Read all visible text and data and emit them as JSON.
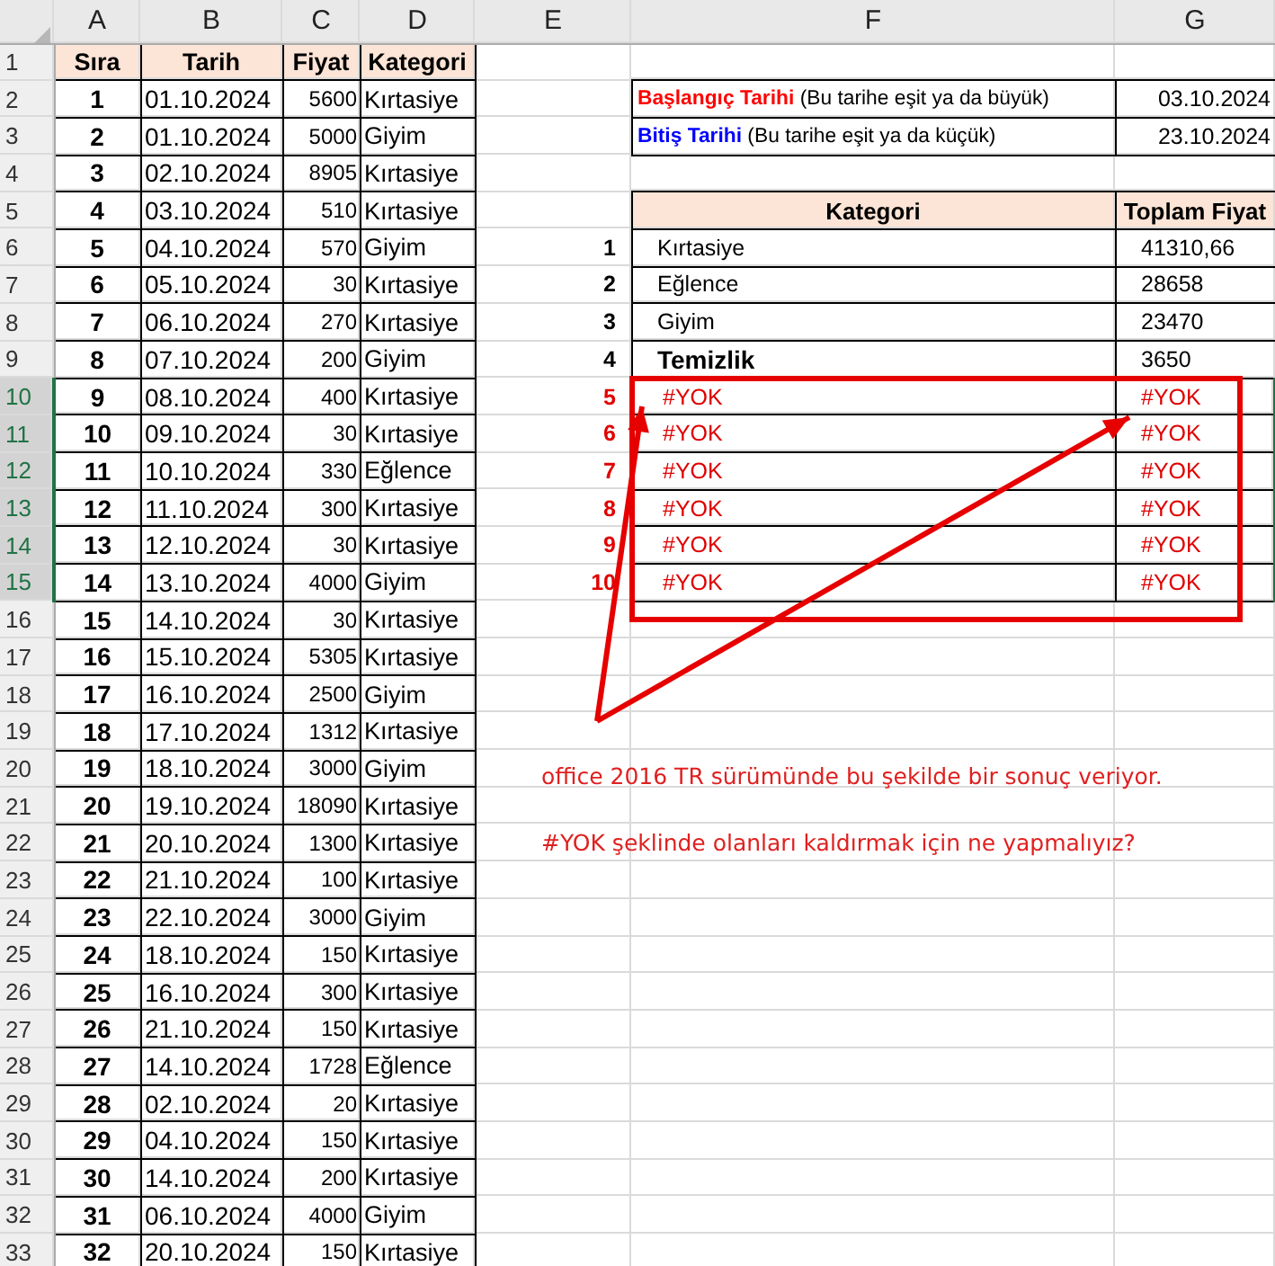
{
  "column_headers": [
    {
      "label": "A"
    },
    {
      "label": "B"
    },
    {
      "label": "C"
    },
    {
      "label": "D"
    },
    {
      "label": "E"
    },
    {
      "label": "F"
    },
    {
      "label": "G"
    }
  ],
  "row_headers": [
    {
      "label": "1",
      "selected": false
    },
    {
      "label": "2",
      "selected": false
    },
    {
      "label": "3",
      "selected": false
    },
    {
      "label": "4",
      "selected": false
    },
    {
      "label": "5",
      "selected": false
    },
    {
      "label": "6",
      "selected": false
    },
    {
      "label": "7",
      "selected": false
    },
    {
      "label": "8",
      "selected": false
    },
    {
      "label": "9",
      "selected": false
    },
    {
      "label": "10",
      "selected": true
    },
    {
      "label": "11",
      "selected": true
    },
    {
      "label": "12",
      "selected": true
    },
    {
      "label": "13",
      "selected": true
    },
    {
      "label": "14",
      "selected": true
    },
    {
      "label": "15",
      "selected": true
    },
    {
      "label": "16",
      "selected": false
    },
    {
      "label": "17",
      "selected": false
    },
    {
      "label": "18",
      "selected": false
    },
    {
      "label": "19",
      "selected": false
    },
    {
      "label": "20",
      "selected": false
    },
    {
      "label": "21",
      "selected": false
    },
    {
      "label": "22",
      "selected": false
    },
    {
      "label": "23",
      "selected": false
    },
    {
      "label": "24",
      "selected": false
    },
    {
      "label": "25",
      "selected": false
    },
    {
      "label": "26",
      "selected": false
    },
    {
      "label": "27",
      "selected": false
    },
    {
      "label": "28",
      "selected": false
    },
    {
      "label": "29",
      "selected": false
    },
    {
      "label": "30",
      "selected": false
    },
    {
      "label": "31",
      "selected": false
    },
    {
      "label": "32",
      "selected": false
    },
    {
      "label": "33",
      "selected": false
    }
  ],
  "data_table": {
    "header": [
      "Sıra",
      "Tarih",
      "Fiyat",
      "Kategori"
    ],
    "rows": [
      {
        "sira": "1",
        "tarih": "01.10.2024",
        "fiyat": "5600",
        "kategori": "Kırtasiye"
      },
      {
        "sira": "2",
        "tarih": "01.10.2024",
        "fiyat": "5000",
        "kategori": "Giyim"
      },
      {
        "sira": "3",
        "tarih": "02.10.2024",
        "fiyat": "8905",
        "kategori": "Kırtasiye"
      },
      {
        "sira": "4",
        "tarih": "03.10.2024",
        "fiyat": "510",
        "kategori": "Kırtasiye"
      },
      {
        "sira": "5",
        "tarih": "04.10.2024",
        "fiyat": "570",
        "kategori": "Giyim"
      },
      {
        "sira": "6",
        "tarih": "05.10.2024",
        "fiyat": "30",
        "kategori": "Kırtasiye"
      },
      {
        "sira": "7",
        "tarih": "06.10.2024",
        "fiyat": "270",
        "kategori": "Kırtasiye"
      },
      {
        "sira": "8",
        "tarih": "07.10.2024",
        "fiyat": "200",
        "kategori": "Giyim"
      },
      {
        "sira": "9",
        "tarih": "08.10.2024",
        "fiyat": "400",
        "kategori": "Kırtasiye"
      },
      {
        "sira": "10",
        "tarih": "09.10.2024",
        "fiyat": "30",
        "kategori": "Kırtasiye"
      },
      {
        "sira": "11",
        "tarih": "10.10.2024",
        "fiyat": "330",
        "kategori": "Eğlence"
      },
      {
        "sira": "12",
        "tarih": "11.10.2024",
        "fiyat": "300",
        "kategori": "Kırtasiye"
      },
      {
        "sira": "13",
        "tarih": "12.10.2024",
        "fiyat": "30",
        "kategori": "Kırtasiye"
      },
      {
        "sira": "14",
        "tarih": "13.10.2024",
        "fiyat": "4000",
        "kategori": "Giyim"
      },
      {
        "sira": "15",
        "tarih": "14.10.2024",
        "fiyat": "30",
        "kategori": "Kırtasiye"
      },
      {
        "sira": "16",
        "tarih": "15.10.2024",
        "fiyat": "5305",
        "kategori": "Kırtasiye"
      },
      {
        "sira": "17",
        "tarih": "16.10.2024",
        "fiyat": "2500",
        "kategori": "Giyim"
      },
      {
        "sira": "18",
        "tarih": "17.10.2024",
        "fiyat": "1312",
        "kategori": "Kırtasiye"
      },
      {
        "sira": "19",
        "tarih": "18.10.2024",
        "fiyat": "3000",
        "kategori": "Giyim"
      },
      {
        "sira": "20",
        "tarih": "19.10.2024",
        "fiyat": "18090",
        "kategori": "Kırtasiye"
      },
      {
        "sira": "21",
        "tarih": "20.10.2024",
        "fiyat": "1300",
        "kategori": "Kırtasiye"
      },
      {
        "sira": "22",
        "tarih": "21.10.2024",
        "fiyat": "100",
        "kategori": "Kırtasiye"
      },
      {
        "sira": "23",
        "tarih": "22.10.2024",
        "fiyat": "3000",
        "kategori": "Giyim"
      },
      {
        "sira": "24",
        "tarih": "18.10.2024",
        "fiyat": "150",
        "kategori": "Kırtasiye"
      },
      {
        "sira": "25",
        "tarih": "16.10.2024",
        "fiyat": "300",
        "kategori": "Kırtasiye"
      },
      {
        "sira": "26",
        "tarih": "21.10.2024",
        "fiyat": "150",
        "kategori": "Kırtasiye"
      },
      {
        "sira": "27",
        "tarih": "14.10.2024",
        "fiyat": "1728",
        "kategori": "Eğlence"
      },
      {
        "sira": "28",
        "tarih": "02.10.2024",
        "fiyat": "20",
        "kategori": "Kırtasiye"
      },
      {
        "sira": "29",
        "tarih": "04.10.2024",
        "fiyat": "150",
        "kategori": "Kırtasiye"
      },
      {
        "sira": "30",
        "tarih": "14.10.2024",
        "fiyat": "200",
        "kategori": "Kırtasiye"
      },
      {
        "sira": "31",
        "tarih": "06.10.2024",
        "fiyat": "4000",
        "kategori": "Giyim"
      },
      {
        "sira": "32",
        "tarih": "20.10.2024",
        "fiyat": "150",
        "kategori": "Kırtasiye"
      }
    ]
  },
  "date_criteria": [
    {
      "label": "Başlangıç Tarihi",
      "note": "(Bu tarihe eşit ya da büyük)",
      "value": "03.10.2024",
      "color": "#ff0000"
    },
    {
      "label": "Bitiş Tarihi",
      "note": "(Bu tarihe eşit ya da küçük)",
      "value": "23.10.2024",
      "color": "#0000ff"
    }
  ],
  "summary": {
    "header": [
      "Kategori",
      "Toplam Fiyat"
    ],
    "rows": [
      {
        "index": "1",
        "category": "Kırtasiye",
        "total": "41310,66",
        "kind": "normal"
      },
      {
        "index": "2",
        "category": "Eğlence",
        "total": "28658",
        "kind": "normal"
      },
      {
        "index": "3",
        "category": "Giyim",
        "total": "23470",
        "kind": "normal"
      },
      {
        "index": "4",
        "category": "Temizlik",
        "total": "3650",
        "kind": "bold"
      },
      {
        "index": "5",
        "category": "#YOK",
        "total": "#YOK",
        "kind": "error"
      },
      {
        "index": "6",
        "category": "#YOK",
        "total": "#YOK",
        "kind": "error"
      },
      {
        "index": "7",
        "category": "#YOK",
        "total": "#YOK",
        "kind": "error"
      },
      {
        "index": "8",
        "category": "#YOK",
        "total": "#YOK",
        "kind": "error"
      },
      {
        "index": "9",
        "category": "#YOK",
        "total": "#YOK",
        "kind": "error"
      },
      {
        "index": "10",
        "category": "#YOK",
        "total": "#YOK",
        "kind": "error"
      }
    ]
  },
  "annotations": [
    "office 2016 TR sürümünde bu şekilde bir sonuç veriyor.",
    "#YOK şeklinde olanları kaldırmak için ne yapmalıyız?"
  ]
}
